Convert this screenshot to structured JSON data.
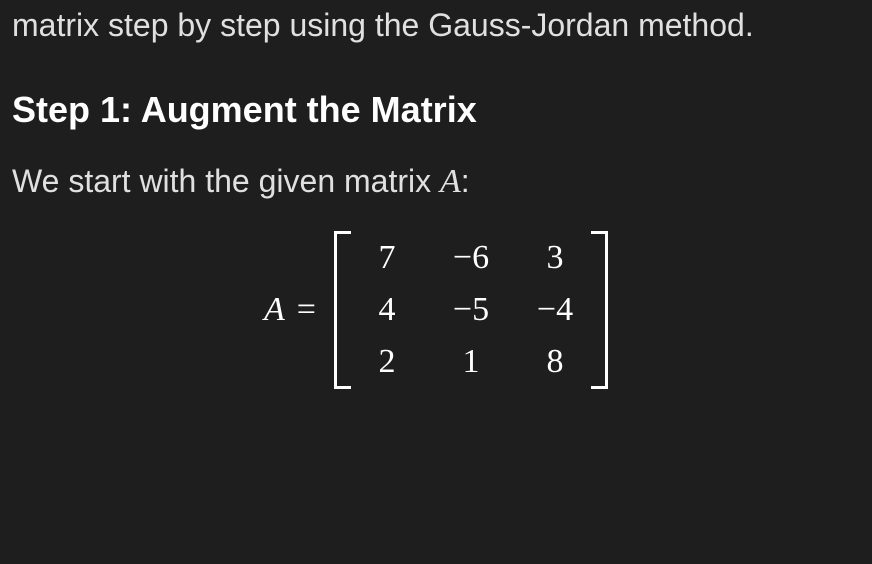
{
  "intro": "matrix step by step using the Gauss-Jordan method.",
  "step_heading": "Step 1: Augment the Matrix",
  "body_prefix": "We start with the given matrix ",
  "matrix_var": "A",
  "body_suffix": ":",
  "equation": {
    "lhs": "A",
    "equals": "=",
    "matrix": {
      "rows": [
        [
          "7",
          "−6",
          "3"
        ],
        [
          "4",
          "−5",
          "−4"
        ],
        [
          "2",
          "1",
          "8"
        ]
      ]
    }
  }
}
